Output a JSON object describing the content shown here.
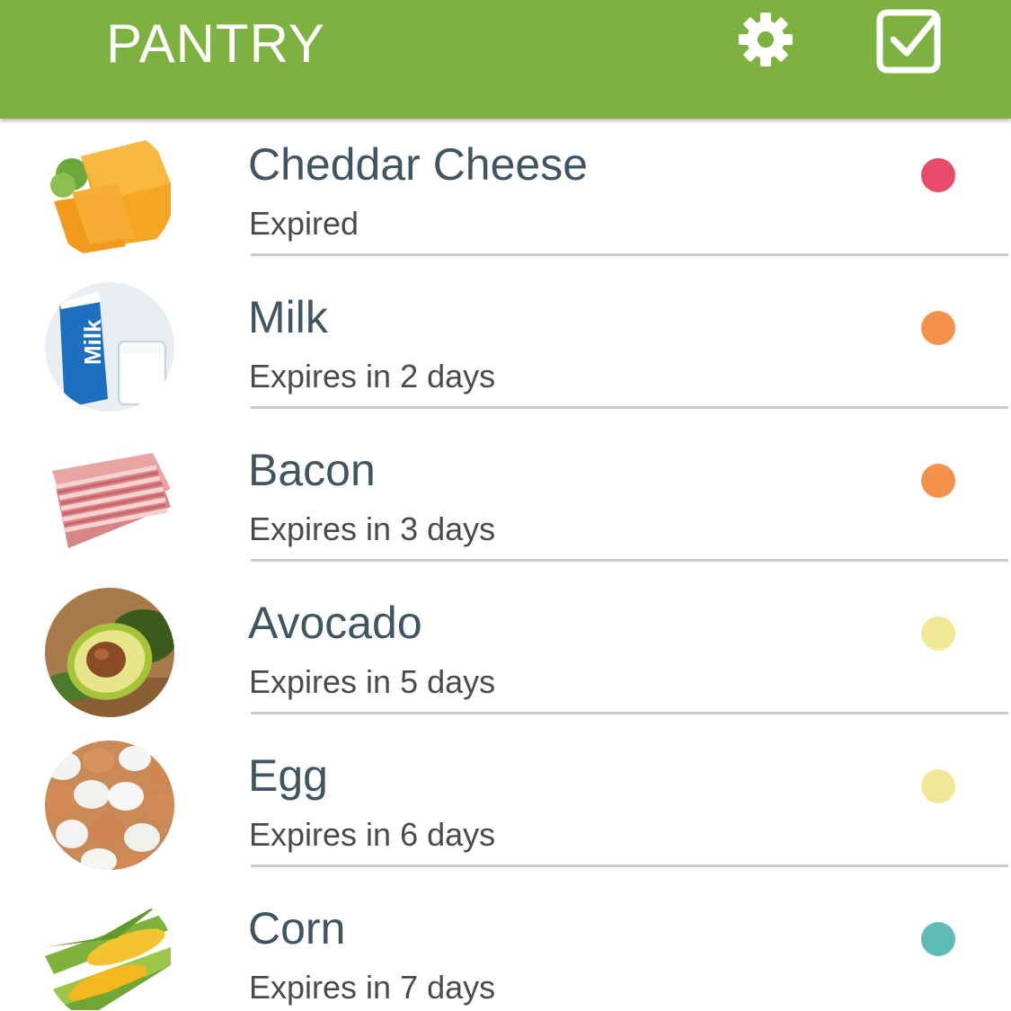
{
  "header": {
    "title": "PANTRY",
    "background_color": "#7db241",
    "settings_icon": "gear-icon",
    "checklist_icon": "checkbox-checked-icon"
  },
  "items": [
    {
      "name": "Cheddar Cheese",
      "status": "Expired",
      "status_color": "#e84a6a",
      "image": "cheddar-cheese-photo"
    },
    {
      "name": "Milk",
      "status": "Expires in 2 days",
      "status_color": "#f4924b",
      "image": "milk-carton-photo"
    },
    {
      "name": "Bacon",
      "status": "Expires in 3 days",
      "status_color": "#f4924b",
      "image": "bacon-strips-photo"
    },
    {
      "name": "Avocado",
      "status": "Expires in 5 days",
      "status_color": "#f1e895",
      "image": "avocado-photo"
    },
    {
      "name": "Egg",
      "status": "Expires in 6 days",
      "status_color": "#f1e895",
      "image": "eggs-photo"
    },
    {
      "name": "Corn",
      "status": "Expires in 7 days",
      "status_color": "#5fbcb5",
      "image": "corn-cob-photo"
    }
  ]
}
